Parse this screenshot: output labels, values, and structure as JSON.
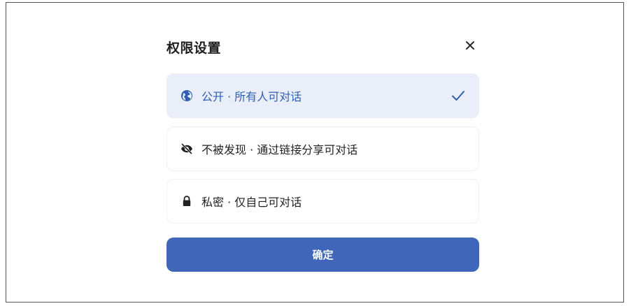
{
  "dialog": {
    "title": "权限设置",
    "close_icon": "close-icon",
    "options": [
      {
        "label": "公开 · 所有人可对话",
        "icon": "globe-icon",
        "selected": true
      },
      {
        "label": "不被发现 · 通过链接分享可对话",
        "icon": "eye-off-icon",
        "selected": false
      },
      {
        "label": "私密 · 仅自己可对话",
        "icon": "lock-icon",
        "selected": false
      }
    ],
    "selected_icon": "checkmark-icon",
    "confirm_label": "确定"
  },
  "colors": {
    "accent": "#3f66b8",
    "selected_bg": "#e9eef8",
    "selected_text": "#2f5fb3",
    "text": "#222222"
  }
}
